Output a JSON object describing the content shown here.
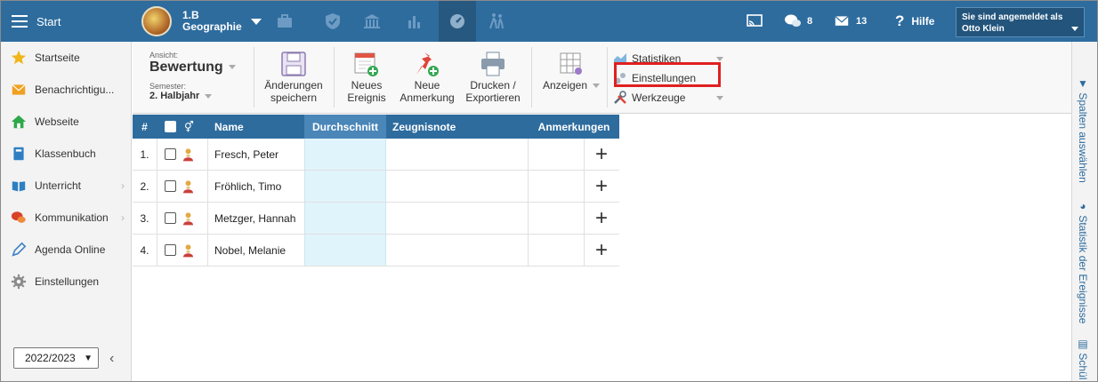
{
  "topbar": {
    "start_label": "Start",
    "class_line1": "1.B",
    "class_line2": "Geographie",
    "messages_count": "8",
    "mail_count": "13",
    "help_label": "Hilfe",
    "login_line1": "Sie sind angemeldet als",
    "login_user": "Otto Klein",
    "icons": [
      "briefcase-icon",
      "shield-check-icon",
      "bank-icon",
      "bar-chart-icon",
      "gauge-icon",
      "walking-persons-icon"
    ]
  },
  "sidebar": {
    "items": [
      {
        "label": "Startseite",
        "icon": "star-icon"
      },
      {
        "label": "Benachrichtigu...",
        "icon": "envelope-icon"
      },
      {
        "label": "Webseite",
        "icon": "home-icon"
      },
      {
        "label": "Klassenbuch",
        "icon": "book-icon"
      },
      {
        "label": "Unterricht",
        "icon": "open-book-icon",
        "chevron": "›"
      },
      {
        "label": "Kommunikation",
        "icon": "chat-icon",
        "chevron": "›"
      },
      {
        "label": "Agenda Online",
        "icon": "pen-icon"
      },
      {
        "label": "Einstellungen",
        "icon": "gear-icon"
      }
    ],
    "year": "2022/2023",
    "collapse": "‹"
  },
  "toolbar": {
    "view_small": "Ansicht:",
    "view_value": "Bewertung",
    "semester_small": "Semester:",
    "semester_value": "2. Halbjahr",
    "save_line1": "Änderungen",
    "save_line2": "speichern",
    "event_line1": "Neues",
    "event_line2": "Ereignis",
    "note_line1": "Neue",
    "note_line2": "Anmerkung",
    "print_line1": "Drucken /",
    "print_line2": "Exportieren",
    "show_label": "Anzeigen",
    "stats_label": "Statistiken",
    "settings_label": "Einstellungen",
    "tools_label": "Werkzeuge"
  },
  "vtabs": {
    "columns": "Spalten auswählen",
    "stats": "Statistik der Ereignisse",
    "students": "Schül"
  },
  "table": {
    "headers": {
      "num": "#",
      "gender": "⚥",
      "name": "Name",
      "avg": "Durchschnitt",
      "grade": "Zeugnisnote",
      "notes": "Anmerkungen"
    },
    "rows": [
      {
        "num": "1.",
        "name": "Fresch, Peter",
        "add": "+"
      },
      {
        "num": "2.",
        "name": "Fröhlich, Timo",
        "add": "+"
      },
      {
        "num": "3.",
        "name": "Metzger, Hannah",
        "add": "+"
      },
      {
        "num": "4.",
        "name": "Nobel, Melanie",
        "add": "+"
      }
    ]
  }
}
